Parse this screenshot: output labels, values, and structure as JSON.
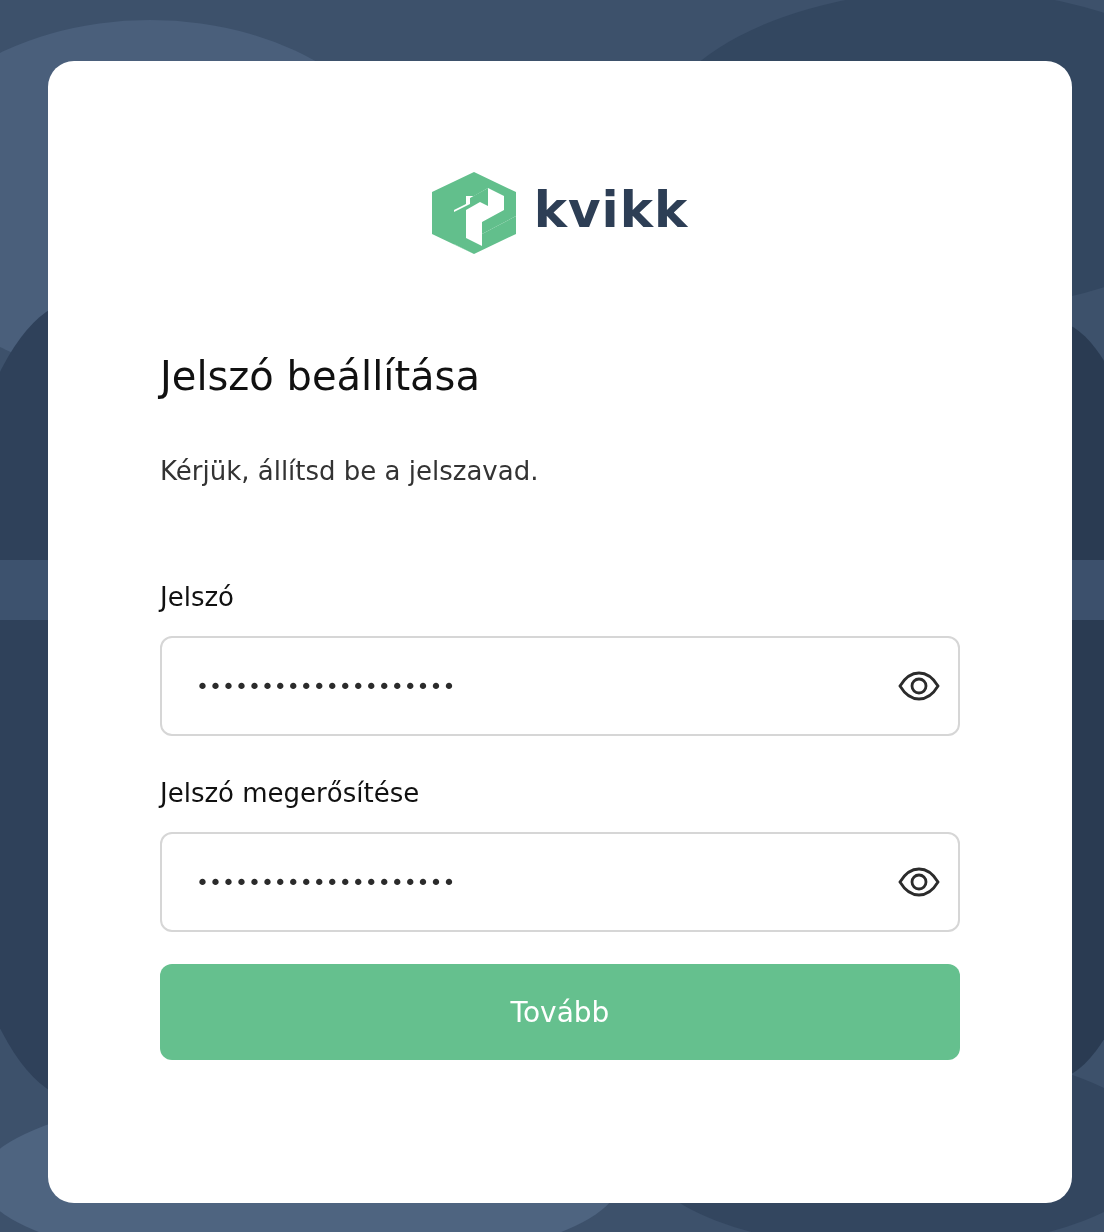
{
  "logo": {
    "wordmark": "kvikk"
  },
  "title": "Jelszó beállítása",
  "subtitle": "Kérjük, állítsd be a jelszavad.",
  "fields": [
    {
      "label": "Jelszó",
      "value": "••••••••••••••••••••"
    },
    {
      "label": "Jelszó megerősítése",
      "value": "••••••••••••••••••••"
    }
  ],
  "submit_button": "Tovább"
}
